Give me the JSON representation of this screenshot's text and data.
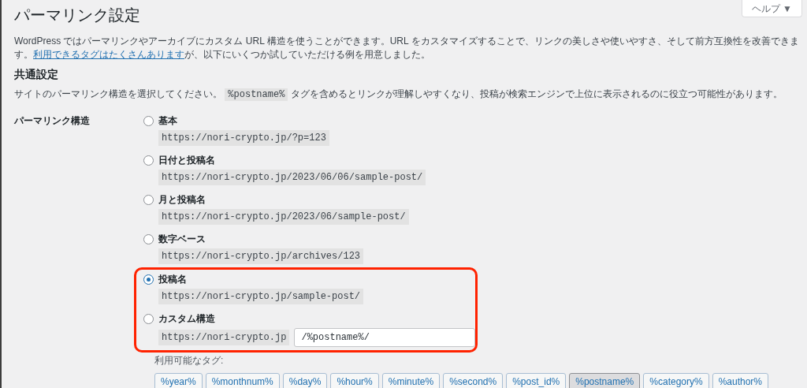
{
  "help_button": {
    "label": "ヘルプ ▼"
  },
  "title": "パーマリンク設定",
  "intro": {
    "before": "WordPress ではパーマリンクやアーカイブにカスタム URL 構造を使うことができます。URL をカスタマイズすることで、リンクの美しさや使いやすさ、そして前方互換性を改善できます。",
    "link": "利用できるタグはたくさんあります",
    "after": "が、以下にいくつか試していただける例を用意しました。"
  },
  "section_heading": "共通設定",
  "description": {
    "before": "サイトのパーマリンク構造を選択してください。",
    "code": "%postname%",
    "after": "タグを含めるとリンクが理解しやすくなり、投稿が検索エンジンで上位に表示されるのに役立つ可能性があります。"
  },
  "field_label": "パーマリンク構造",
  "options": [
    {
      "kind": "preset",
      "label": "基本",
      "url": "https://nori-crypto.jp/?p=123",
      "selected": false,
      "highlighted": false
    },
    {
      "kind": "preset",
      "label": "日付と投稿名",
      "url": "https://nori-crypto.jp/2023/06/06/sample-post/",
      "selected": false,
      "highlighted": false
    },
    {
      "kind": "preset",
      "label": "月と投稿名",
      "url": "https://nori-crypto.jp/2023/06/sample-post/",
      "selected": false,
      "highlighted": false
    },
    {
      "kind": "preset",
      "label": "数字ベース",
      "url": "https://nori-crypto.jp/archives/123",
      "selected": false,
      "highlighted": false
    },
    {
      "kind": "preset",
      "label": "投稿名",
      "url": "https://nori-crypto.jp/sample-post/",
      "selected": true,
      "highlighted": true
    },
    {
      "kind": "custom",
      "label": "カスタム構造",
      "url": "https://nori-crypto.jp",
      "value": "/%postname%/",
      "selected": false,
      "highlighted": true
    }
  ],
  "available_tags_label": "利用可能なタグ:",
  "tags": [
    {
      "label": "%year%",
      "selected": false
    },
    {
      "label": "%monthnum%",
      "selected": false
    },
    {
      "label": "%day%",
      "selected": false
    },
    {
      "label": "%hour%",
      "selected": false
    },
    {
      "label": "%minute%",
      "selected": false
    },
    {
      "label": "%second%",
      "selected": false
    },
    {
      "label": "%post_id%",
      "selected": false
    },
    {
      "label": "%postname%",
      "selected": true
    },
    {
      "label": "%category%",
      "selected": false
    },
    {
      "label": "%author%",
      "selected": false
    }
  ]
}
